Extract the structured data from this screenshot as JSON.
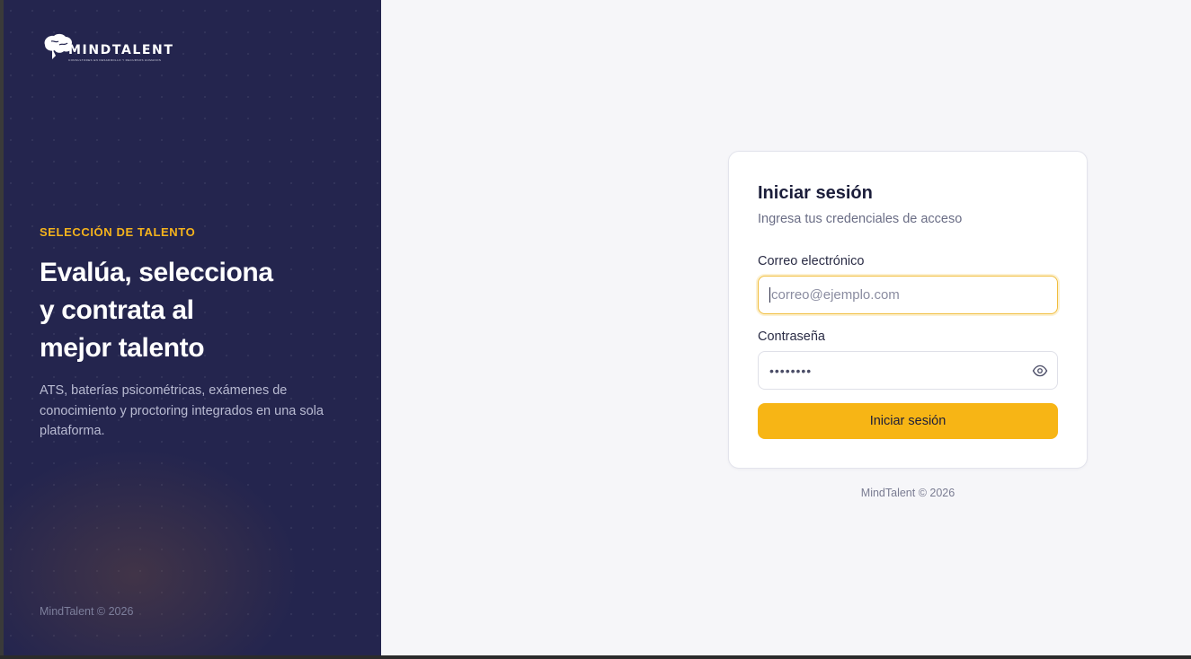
{
  "brand": {
    "logo_word": "MINDTALENT",
    "tagline": "CONSULTORES EN DESARROLLO Y RECURSOS HUMANOS",
    "accent_color": "#f7b515",
    "panel_color": "#24254e"
  },
  "hero": {
    "eyebrow": "SELECCIÓN DE TALENTO",
    "headline": [
      "Evalúa, selecciona",
      "y contrata al",
      "mejor talento"
    ],
    "description": "ATS, baterías psicométricas, exámenes de conocimiento y proctoring integrados en una sola plataforma.",
    "footer": "MindTalent © 2026"
  },
  "login": {
    "title": "Iniciar sesión",
    "subtitle": "Ingresa tus credenciales de acceso",
    "email_label": "Correo electrónico",
    "email_placeholder": "correo@ejemplo.com",
    "email_value": "",
    "password_label": "Contraseña",
    "password_masked": "••••••••",
    "password_toggle_icon": "eye-icon",
    "submit_label": "Iniciar sesión"
  },
  "footer": {
    "text": "MindTalent © 2026"
  }
}
